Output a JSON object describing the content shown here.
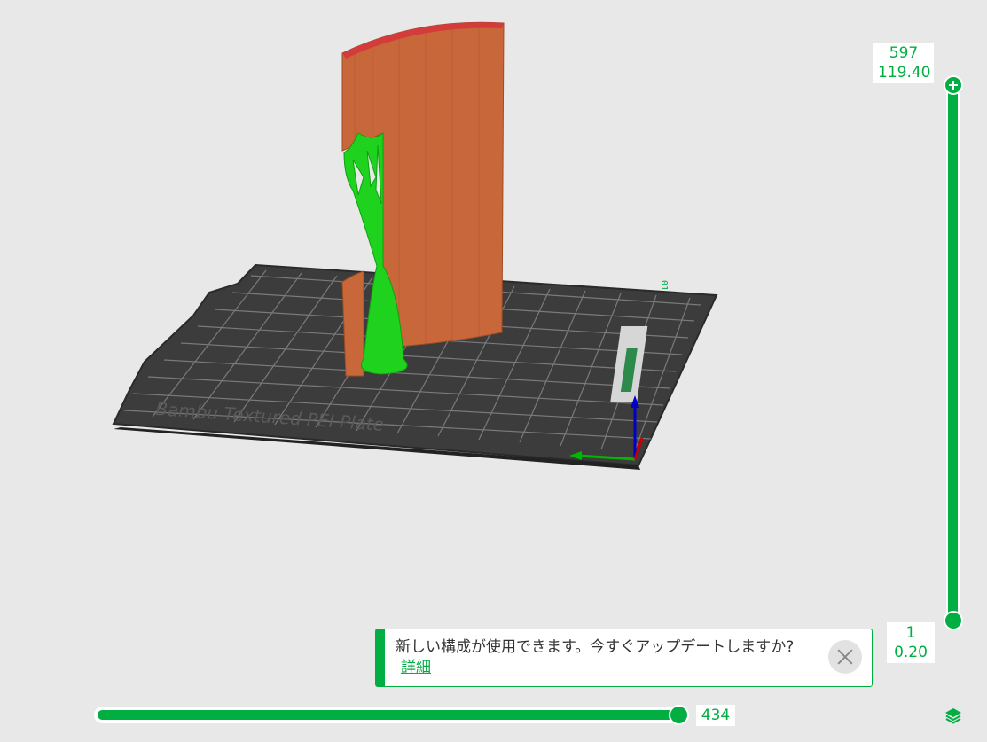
{
  "layer_slider": {
    "top_layer": "597",
    "top_height": "119.40",
    "bottom_layer": "1",
    "bottom_height": "0.20"
  },
  "move_slider": {
    "value": "434",
    "progress": 0.98
  },
  "notification": {
    "message": "新しい構成が使用できます。今すぐアップデートしますか?",
    "link_label": "詳細"
  },
  "plate": {
    "label": "Bambu Textured PEI Plate",
    "plate_number": "01"
  },
  "icons": {
    "close": "close-icon",
    "layers": "layers-icon",
    "plus": "plus-icon"
  },
  "colors": {
    "accent": "#00ae42",
    "wall": "#c86a33",
    "support": "#1ed21e",
    "plate": "#3a3a3a"
  }
}
